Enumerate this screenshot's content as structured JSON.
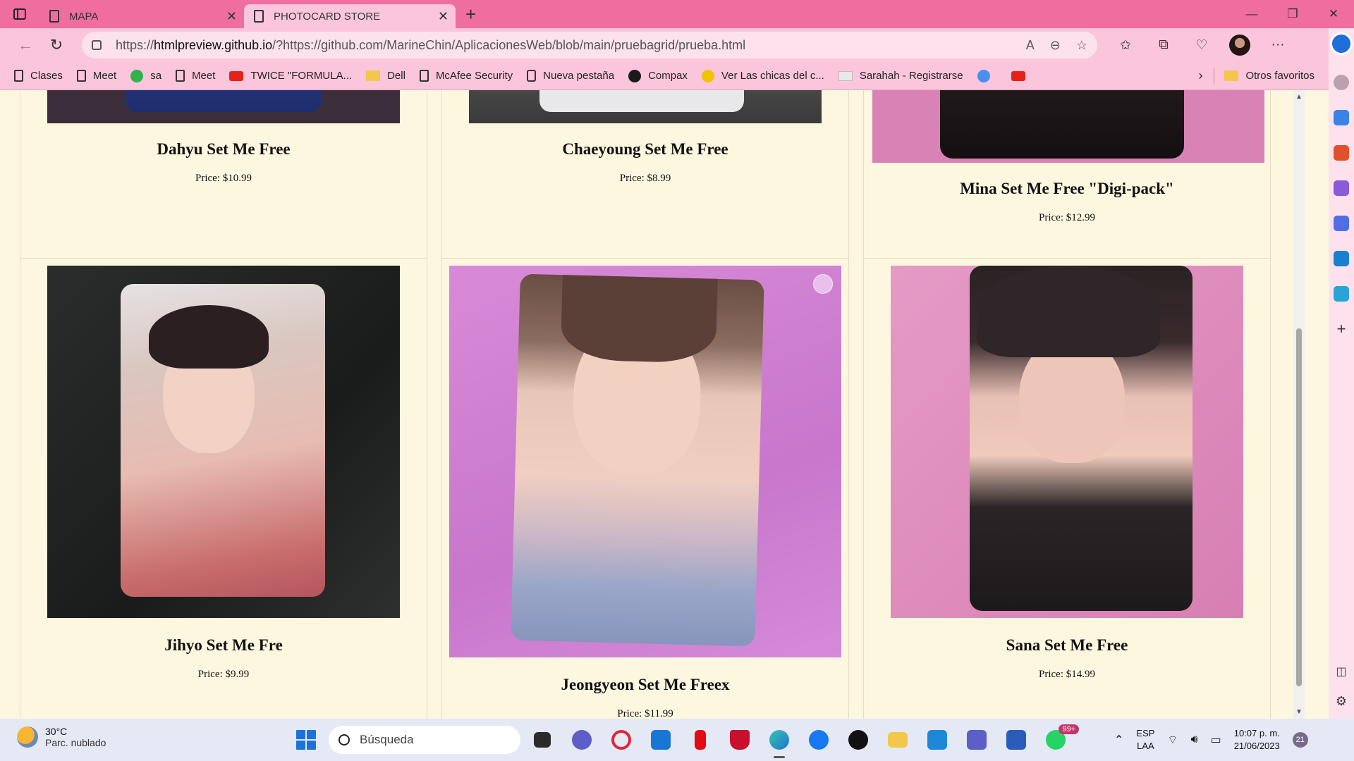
{
  "browser": {
    "tabs": [
      {
        "label": "MAPA",
        "active": false
      },
      {
        "label": "PHOTOCARD STORE",
        "active": true
      }
    ],
    "url": {
      "prefix": "https://",
      "host": "htmlpreview.github.io",
      "rest": "/?https://github.com/MarineChin/AplicacionesWeb/blob/main/pruebagrid/prueba.html"
    },
    "bookmarks": [
      {
        "label": "Clases",
        "icon": "page-icon"
      },
      {
        "label": "Meet",
        "icon": "page-icon"
      },
      {
        "label": "sa",
        "icon": "app-icon"
      },
      {
        "label": "Meet",
        "icon": "page-icon"
      },
      {
        "label": "TWICE \"FORMULA...",
        "icon": "youtube-icon"
      },
      {
        "label": "Dell",
        "icon": "folder-icon"
      },
      {
        "label": "McAfee Security",
        "icon": "page-icon"
      },
      {
        "label": "Nueva pestaña",
        "icon": "calendar-icon"
      },
      {
        "label": "Compax",
        "icon": "app-icon"
      },
      {
        "label": "Ver Las chicas del c...",
        "icon": "play-icon"
      },
      {
        "label": "Sarahah - Registrarse",
        "icon": "mail-icon"
      }
    ],
    "other_favorites": "Otros favoritos"
  },
  "products": [
    {
      "name": "Dahyu Set Me Free",
      "price": "Price: $10.99"
    },
    {
      "name": "Chaeyoung Set Me Free",
      "price": "Price: $8.99"
    },
    {
      "name": "Mina Set Me Free \"Digi-pack\"",
      "price": "Price: $12.99"
    },
    {
      "name": "Jihyo Set Me Fre",
      "price": "Price: $9.99"
    },
    {
      "name": "Jeongyeon Set Me Freex",
      "price": "Price: $11.99"
    },
    {
      "name": "Sana Set Me Free",
      "price": "Price: $14.99"
    }
  ],
  "taskbar": {
    "weather_temp": "30°C",
    "weather_condition": "Parc. nublado",
    "search_placeholder": "Búsqueda",
    "whatsapp_badge": "99+",
    "lang_1": "ESP",
    "lang_2": "LAA",
    "time": "10:07 p. m.",
    "date": "21/06/2023",
    "notifications": "21"
  },
  "colors": {
    "tabbar": "#f06da0",
    "toolbar": "#fbc6db",
    "page_bg": "#fdf7df"
  }
}
